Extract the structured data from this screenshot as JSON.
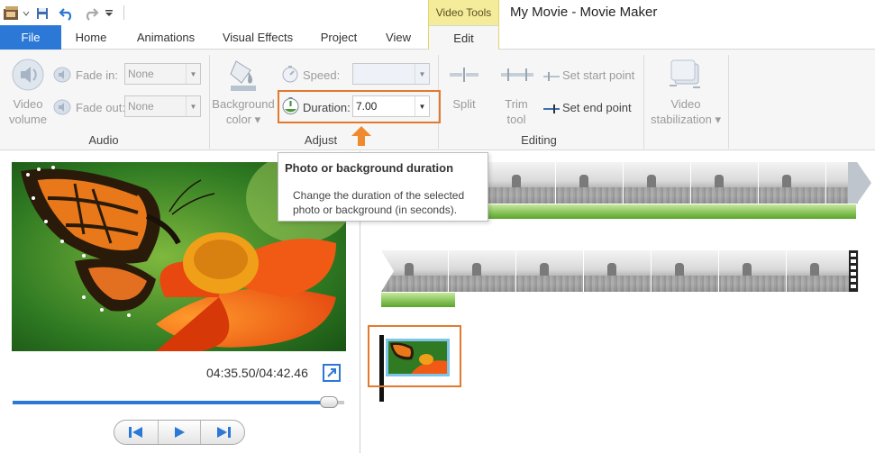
{
  "window": {
    "title": "My Movie - Movie Maker",
    "contextual_tab_group": "Video Tools"
  },
  "tabs": {
    "file": "File",
    "home": "Home",
    "animations": "Animations",
    "visual_effects": "Visual Effects",
    "project": "Project",
    "view": "View",
    "edit": "Edit"
  },
  "ribbon": {
    "audio": {
      "group_label": "Audio",
      "video_volume_label": "Video\nvolume",
      "fade_in_label": "Fade in:",
      "fade_in_value": "None",
      "fade_out_label": "Fade out:",
      "fade_out_value": "None"
    },
    "adjust": {
      "group_label": "Adjust",
      "background_color_label": "Background\ncolor ▾",
      "speed_label": "Speed:",
      "speed_value": "",
      "duration_label": "Duration:",
      "duration_value": "7.00"
    },
    "editing": {
      "group_label": "Editing",
      "split_label": "Split",
      "trim_tool_label": "Trim\ntool",
      "set_start_point_label": "Set start point",
      "set_end_point_label": "Set end point"
    },
    "stabilization": {
      "label": "Video\nstabilization ▾"
    }
  },
  "tooltip": {
    "title": "Photo or background duration",
    "body": "Change the duration of the selected photo or background (in seconds)."
  },
  "preview": {
    "timecode": "04:35.50/04:42.46",
    "seek_progress": 0.953
  },
  "colors": {
    "accent": "#2b78d6",
    "highlight": "#e27a2e",
    "contextual_tab": "#f4ec9a"
  },
  "icons": {
    "qat": [
      "movie-maker-app-icon",
      "save-icon",
      "undo-icon",
      "redo-icon",
      "customize-qat-icon"
    ],
    "transport": [
      "previous-frame-icon",
      "play-icon",
      "next-frame-icon"
    ]
  }
}
